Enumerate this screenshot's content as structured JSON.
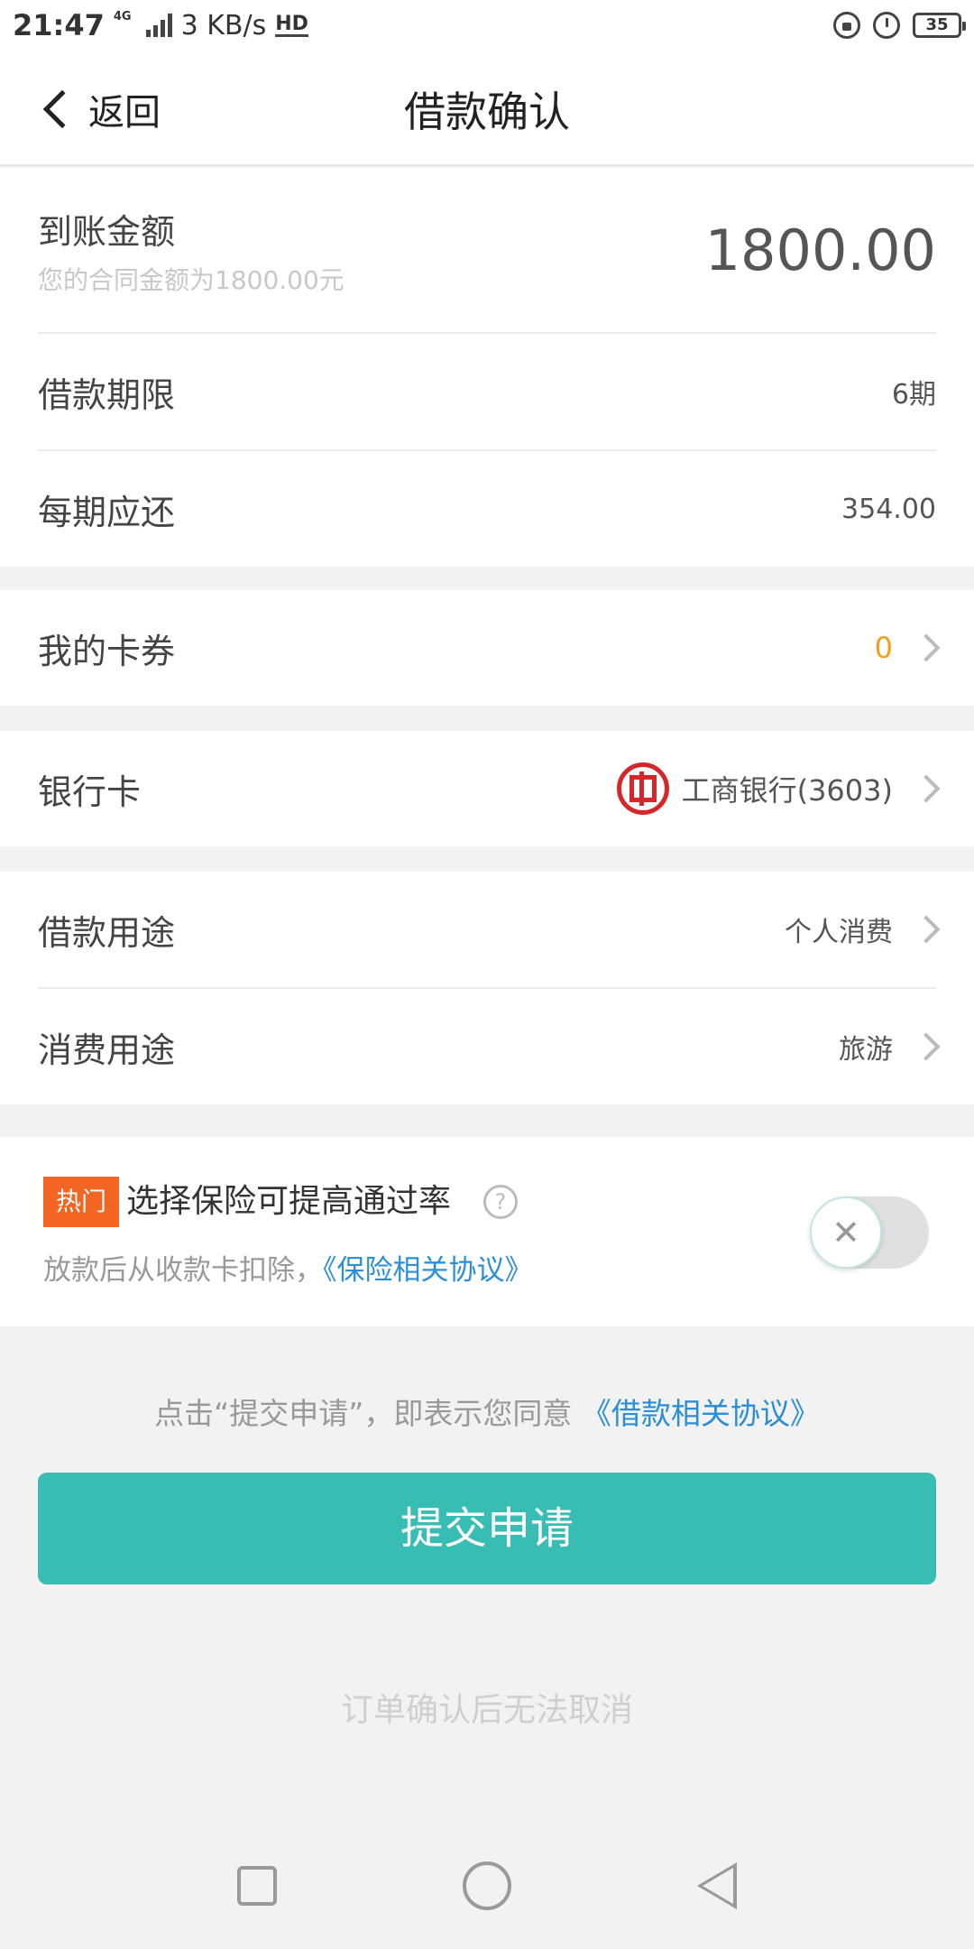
{
  "status_bar": {
    "time": "21:47",
    "network_type": "4G",
    "speed": "3 KB/s",
    "hd": "HD",
    "battery": "35"
  },
  "header": {
    "back_label": "返回",
    "title": "借款确认"
  },
  "amount": {
    "label": "到账金额",
    "sub": "您的合同金额为1800.00元",
    "value": "1800.00"
  },
  "term": {
    "label": "借款期限",
    "value": "6期"
  },
  "installment": {
    "label": "每期应还",
    "value": "354.00"
  },
  "coupons": {
    "label": "我的卡券",
    "value": "0"
  },
  "bank_card": {
    "label": "银行卡",
    "value": "工商银行(3603)",
    "logo_icon": "icbc-logo-icon"
  },
  "purpose": {
    "label": "借款用途",
    "value": "个人消费"
  },
  "consumption": {
    "label": "消费用途",
    "value": "旅游"
  },
  "insurance": {
    "badge": "热门",
    "title": "选择保险可提高通过率",
    "help": "?",
    "sub": "放款后从收款卡扣除，",
    "link": "《保险相关协议》",
    "toggle_on": false
  },
  "agreement": {
    "text": "点击“提交申请”，即表示您同意 ",
    "link": "《借款相关协议》"
  },
  "submit_label": "提交申请",
  "note": "订单确认后无法取消",
  "colors": {
    "accent": "#38bdb4",
    "link": "#2a8fd6",
    "hot_badge": "#f26522",
    "coupon": "#f0a020",
    "bank_red": "#d6262a"
  }
}
